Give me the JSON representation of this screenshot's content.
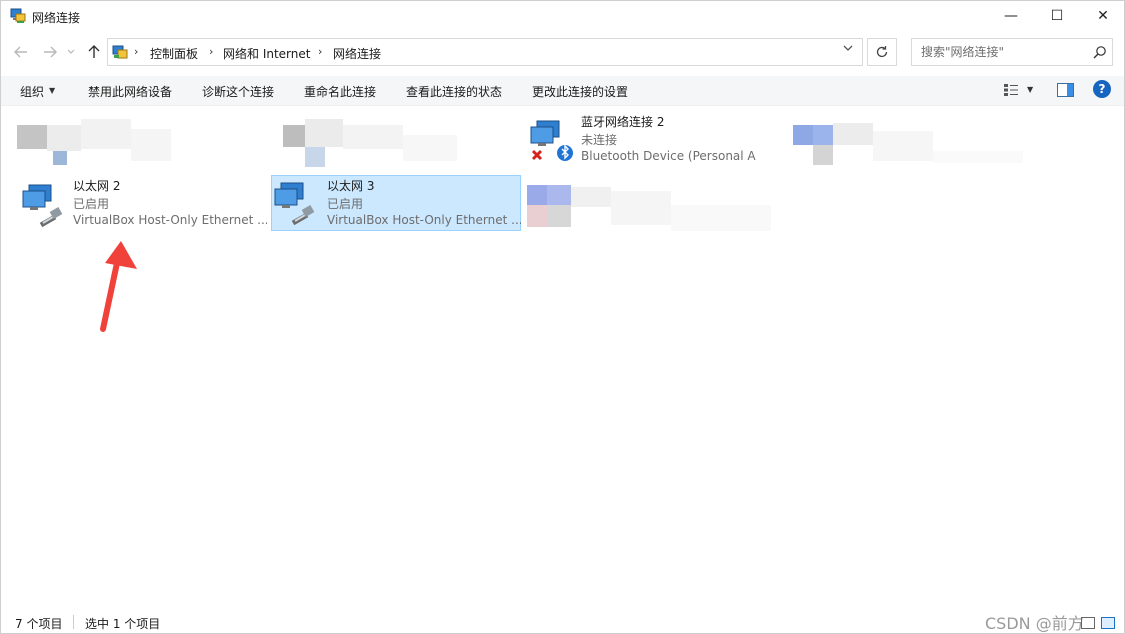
{
  "window": {
    "title": "网络连接",
    "minimize_glyph": "—",
    "maximize_glyph": "☐",
    "close_glyph": "✕"
  },
  "nav": {
    "back_icon": "arrow-left-icon",
    "forward_icon": "arrow-right-icon",
    "recent_icon": "chevron-down-icon",
    "up_icon": "arrow-up-icon"
  },
  "address": {
    "breadcrumbs": [
      "控制面板",
      "网络和 Internet",
      "网络连接"
    ],
    "separator": "›"
  },
  "search": {
    "placeholder": "搜索\"网络连接\""
  },
  "toolbar": {
    "organize": "组织",
    "disable_device": "禁用此网络设备",
    "diagnose": "诊断这个连接",
    "rename": "重命名此连接",
    "view_status": "查看此连接的状态",
    "change_settings": "更改此连接的设置",
    "help": "?"
  },
  "connections": [
    {
      "name": "以太网 2",
      "status": "已启用",
      "device": "VirtualBox Host-Only Ethernet ...",
      "selected": false,
      "icon": "ethernet-adapter-icon"
    },
    {
      "name": "以太网 3",
      "status": "已启用",
      "device": "VirtualBox Host-Only Ethernet ...",
      "selected": true,
      "icon": "ethernet-adapter-icon"
    },
    {
      "name": "蓝牙网络连接 2",
      "status": "未连接",
      "device": "Bluetooth Device (Personal A",
      "selected": false,
      "icon": "bluetooth-adapter-icon"
    }
  ],
  "status": {
    "item_count": "7 个项目",
    "selected_count": "选中 1 个项目",
    "watermark": "CSDN @前方"
  },
  "colors": {
    "selection_bg": "#cce8ff",
    "selection_border": "#99d1ff",
    "arrow": "#f0423a",
    "help": "#1665c1"
  }
}
